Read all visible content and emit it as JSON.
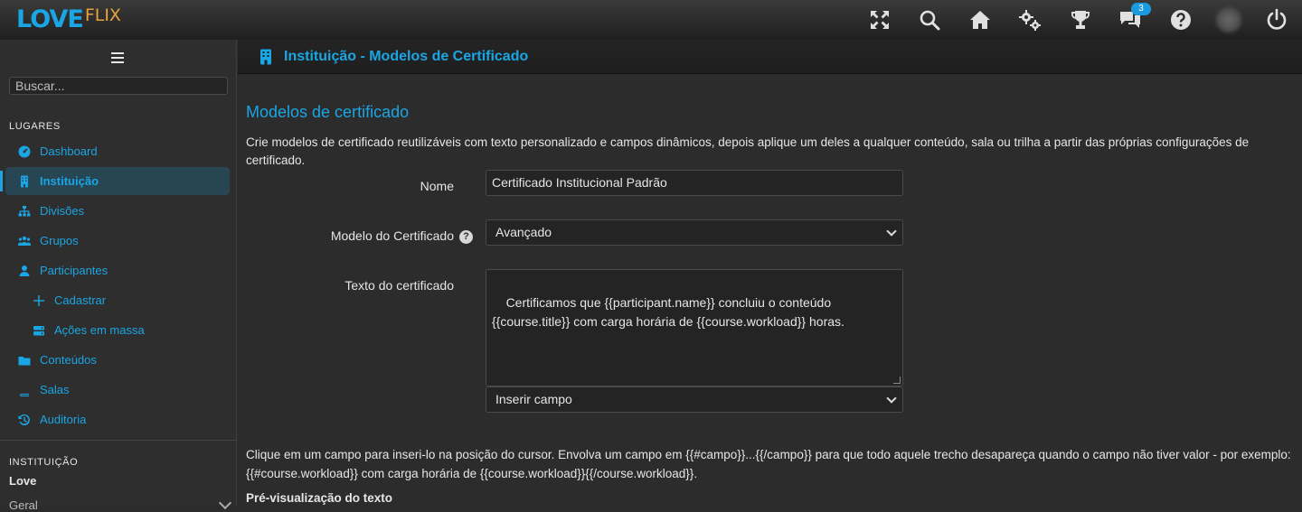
{
  "app": {
    "logo_love": "LOVE",
    "logo_flix": "FLIX",
    "accent": "#1aa6e4"
  },
  "topbar": {
    "icons": [
      "fullscreen-icon",
      "search-icon",
      "home-icon",
      "gears-icon",
      "trophy-icon",
      "chat-icon",
      "help-icon",
      "avatar",
      "power-icon"
    ],
    "chat_badge": "3"
  },
  "sidebar": {
    "search_placeholder": "Buscar...",
    "section_places": "LUGARES",
    "items": [
      {
        "label": "Dashboard",
        "icon": "dashboard-icon"
      },
      {
        "label": "Instituição",
        "icon": "building-icon",
        "active": true
      },
      {
        "label": "Divisões",
        "icon": "sitemap-icon"
      },
      {
        "label": "Grupos",
        "icon": "users-icon"
      },
      {
        "label": "Participantes",
        "icon": "user-icon"
      },
      {
        "label": "Cadastrar",
        "icon": "plus-icon",
        "sub": true
      },
      {
        "label": "Ações em massa",
        "icon": "server-icon",
        "sub": true
      },
      {
        "label": "Conteúdos",
        "icon": "folder-icon"
      },
      {
        "label": "Salas",
        "icon": "book-icon"
      },
      {
        "label": "Auditoria",
        "icon": "history-icon"
      }
    ],
    "section_institution": "INSTITUIÇÃO",
    "institution_name": "Love",
    "institution_sub": "Geral"
  },
  "header": {
    "title": "Instituição - Modelos de Certificado"
  },
  "main": {
    "heading": "Modelos de certificado",
    "description": "Crie modelos de certificado reutilizáveis com texto personalizado e campos dinâmicos, depois aplique um deles a qualquer conteúdo, sala ou trilha a partir das próprias configurações de certificado.",
    "name_label": "Nome",
    "name_value": "Certificado Institucional Padrão",
    "model_label": "Modelo do Certificado",
    "model_value": "Avançado",
    "text_label": "Texto do certificado",
    "text_value": "Certificamos que {{participant.name}} concluiu o conteúdo {{course.title}} com carga horária de {{course.workload}} horas.",
    "insert_field": "Inserir campo",
    "help_text": "Clique em um campo para inseri-lo na posição do cursor. Envolva um campo em {{#campo}}...{{/campo}} para que todo aquele trecho desapareça quando o campo não tiver valor - por exemplo: {{#course.workload}} com carga horária de {{course.workload}}{{/course.workload}}.",
    "preview_title": "Pré-visualização do texto"
  }
}
